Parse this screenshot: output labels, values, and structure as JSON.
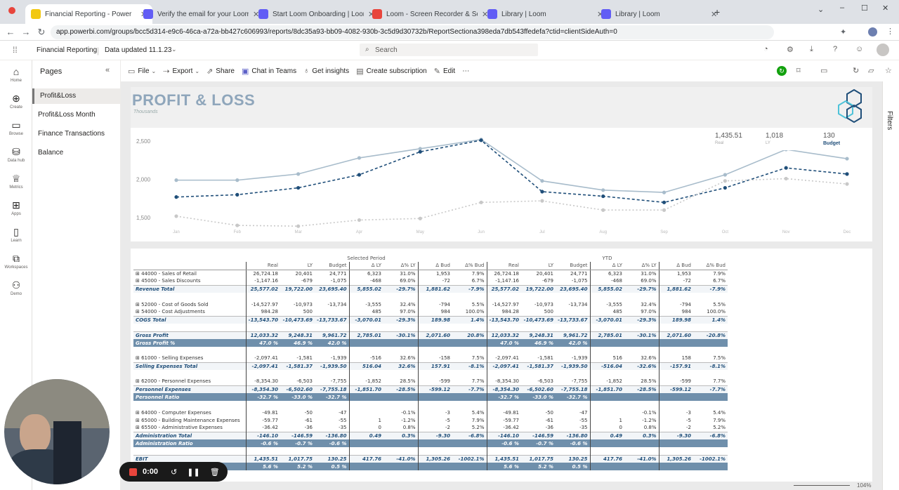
{
  "browser": {
    "tabs": [
      {
        "label": "Financial Reporting - Power",
        "color": "#f2c811",
        "active": true
      },
      {
        "label": "Verify the email for your Loom",
        "color": "#625df5",
        "active": false
      },
      {
        "label": "Start Loom Onboarding | Loom",
        "color": "#625df5",
        "active": false
      },
      {
        "label": "Loom - Screen Recorder & Scre",
        "color": "#e8453c",
        "active": false
      },
      {
        "label": "Library | Loom",
        "color": "#625df5",
        "active": false
      },
      {
        "label": "Library | Loom",
        "color": "#625df5",
        "active": false
      }
    ],
    "url": "app.powerbi.com/groups/bcc5d314-e9c6-46ca-a72a-bb427c606993/reports/8dc35a93-bb09-4082-930b-3c5d9d30732b/ReportSectiona398eda7db543ffedefa?ctid=clientSideAuth=0"
  },
  "pbi": {
    "report_name": "Financial Reporting",
    "data_updated": "Data updated 11.1.23",
    "search_placeholder": "Search"
  },
  "rail": [
    "Home",
    "Create",
    "Browse",
    "Data hub",
    "Metrics",
    "Apps",
    "Learn",
    "Workspaces",
    "Demo"
  ],
  "pages": {
    "title": "Pages",
    "items": [
      "Profit&Loss",
      "Profit&Loss Month",
      "Finance Transactions",
      "Balance"
    ]
  },
  "toolbar": {
    "file": "File",
    "export": "Export",
    "share": "Share",
    "chat": "Chat in Teams",
    "insights": "Get insights",
    "subscription": "Create subscription",
    "edit": "Edit"
  },
  "report": {
    "title": "PROFIT & LOSS",
    "subtitle": "Thousands",
    "filters_label": "Filters"
  },
  "kpi": {
    "real": "1,435.51",
    "real_label": "Real",
    "ly": "1,018",
    "ly_label": "LY",
    "budget": "130",
    "budget_label": "Budget"
  },
  "chart_data": {
    "type": "line",
    "x": [
      "Jan",
      "Feb",
      "Mar",
      "Apr",
      "May",
      "Jun",
      "Jul",
      "Aug",
      "Sep",
      "Oct",
      "Nov",
      "Dec"
    ],
    "ylim": [
      1300,
      2600
    ],
    "yticks": [
      "2,500",
      "2,000",
      "1,500"
    ],
    "series": [
      {
        "values": [
          1990,
          1990,
          2070,
          2280,
          2400,
          2520,
          1980,
          1860,
          1830,
          2060,
          2390,
          2270
        ],
        "color": "#a8bccb",
        "dash": ""
      },
      {
        "values": [
          1770,
          1800,
          1890,
          2060,
          2360,
          2510,
          1840,
          1780,
          1700,
          1890,
          2150,
          2070
        ],
        "color": "#1f4e79",
        "dash": "4,3"
      },
      {
        "values": [
          1520,
          1400,
          1390,
          1470,
          1490,
          1700,
          1720,
          1600,
          1600,
          1980,
          2010,
          1940
        ],
        "color": "#c8c8c8",
        "dash": "2,3"
      }
    ]
  },
  "table": {
    "group_selected": "Selected Period",
    "group_ytd": "YTD",
    "headers": [
      "Real",
      "LY",
      "Budget",
      "Δ LY",
      "Δ% LY",
      "Δ Bud",
      "Δ% Bud",
      "Real",
      "LY",
      "Budget",
      "Δ LY",
      "Δ% LY",
      "Δ Bud",
      "Δ% Bud"
    ],
    "rows": [
      {
        "type": "detail",
        "label": "⊞ 44000 - Sales of Retail",
        "v": [
          "26,724.18",
          "20,401",
          "24,771",
          "6,323",
          "31.0%",
          "1,953",
          "7.9%",
          "26,724.18",
          "20,401",
          "24,771",
          "6,323",
          "31.0%",
          "1,953",
          "7.9%"
        ]
      },
      {
        "type": "detail",
        "label": "⊞ 45000 - Sales Discounts",
        "v": [
          "-1,147.16",
          "-679",
          "-1,075",
          "-468",
          "69.0%",
          "-72",
          "6.7%",
          "-1,147.16",
          "-679",
          "-1,075",
          "-468",
          "69.0%",
          "-72",
          "6.7%"
        ]
      },
      {
        "type": "total",
        "label": "Revenue Total",
        "v": [
          "25,577.02",
          "19,722.00",
          "23,695.40",
          "5,855.02",
          "-29.7%",
          "1,881.62",
          "-7.9%",
          "25,577.02",
          "19,722.00",
          "23,695.40",
          "5,855.02",
          "-29.7%",
          "1,881.62",
          "-7.9%"
        ]
      },
      {
        "type": "blank",
        "label": "",
        "v": []
      },
      {
        "type": "detail",
        "label": "⊞ 52000 - Cost of Goods Sold",
        "v": [
          "-14,527.97",
          "-10,973",
          "-13,734",
          "-3,555",
          "32.4%",
          "-794",
          "5.5%",
          "-14,527.97",
          "-10,973",
          "-13,734",
          "-3,555",
          "32.4%",
          "-794",
          "5.5%"
        ]
      },
      {
        "type": "detail",
        "label": "⊞ 54000 - Cost Adjustments",
        "v": [
          "984.28",
          "500",
          "",
          "485",
          "97.0%",
          "984",
          "100.0%",
          "984.28",
          "500",
          "",
          "485",
          "97.0%",
          "984",
          "100.0%"
        ]
      },
      {
        "type": "total",
        "label": "COGS Total",
        "v": [
          "-13,543.70",
          "-10,473.69",
          "-13,733.67",
          "-3,070.01",
          "-29.3%",
          "189.98",
          "1.4%",
          "-13,543.70",
          "-10,473.69",
          "-13,733.67",
          "-3,070.01",
          "-29.3%",
          "189.98",
          "1.4%"
        ]
      },
      {
        "type": "blank",
        "label": "",
        "v": []
      },
      {
        "type": "total",
        "label": "Gross Profit",
        "v": [
          "12,033.32",
          "9,248.31",
          "9,961.72",
          "2,785.01",
          "-30.1%",
          "2,071.60",
          "20.8%",
          "12,033.32",
          "9,248.31",
          "9,961.72",
          "2,785.01",
          "-30.1%",
          "2,071.60",
          "-20.8%"
        ]
      },
      {
        "type": "ratio",
        "label": "Gross Profit %",
        "v": [
          "47.0 %",
          "46.9 %",
          "42.0 %",
          "",
          "",
          "",
          "",
          "47.0 %",
          "46.9 %",
          "42.0 %",
          "",
          "",
          "",
          ""
        ]
      },
      {
        "type": "blank",
        "label": "",
        "v": []
      },
      {
        "type": "detail",
        "label": "⊞ 61000 - Selling Expenses",
        "v": [
          "-2,097.41",
          "-1,581",
          "-1,939",
          "-516",
          "32.6%",
          "-158",
          "7.5%",
          "-2,097.41",
          "-1,581",
          "-1,939",
          "516",
          "32.6%",
          "158",
          "7.5%"
        ]
      },
      {
        "type": "total",
        "label": "Selling Expenses Total",
        "v": [
          "-2,097.41",
          "-1,581.37",
          "-1,939.50",
          "516.04",
          "32.6%",
          "157.91",
          "-8.1%",
          "-2,097.41",
          "-1,581.37",
          "-1,939.50",
          "-516.04",
          "-32.6%",
          "-157.91",
          "-8.1%"
        ]
      },
      {
        "type": "blank",
        "label": "",
        "v": []
      },
      {
        "type": "detail",
        "label": "⊞ 62000 - Personnel Expenses",
        "v": [
          "-8,354.30",
          "-6,503",
          "-7,755",
          "-1,852",
          "28.5%",
          "-599",
          "7.7%",
          "-8,354.30",
          "-6,503",
          "-7,755",
          "-1,852",
          "28.5%",
          "-599",
          "7.7%"
        ]
      },
      {
        "type": "total",
        "label": "Personnel Expenses",
        "v": [
          "-8,354.30",
          "-6,502.60",
          "-7,755.18",
          "-1,851.70",
          "-28.5%",
          "-599.12",
          "-7.7%",
          "-8,354.30",
          "-6,502.60",
          "-7,755.18",
          "-1,851.70",
          "-28.5%",
          "-599.12",
          "-7.7%"
        ]
      },
      {
        "type": "ratio",
        "label": "Personnel Ratio",
        "v": [
          "-32.7 %",
          "-33.0 %",
          "-32.7 %",
          "",
          "",
          "",
          "",
          "-32.7 %",
          "-33.0 %",
          "-32.7 %",
          "",
          "",
          "",
          ""
        ]
      },
      {
        "type": "blank",
        "label": "",
        "v": []
      },
      {
        "type": "detail",
        "label": "⊞ 64000 - Computer Expenses",
        "v": [
          "-49.81",
          "-50",
          "-47",
          "",
          "-0.1%",
          "-3",
          "5.4%",
          "-49.81",
          "-50",
          "-47",
          "",
          "-0.1%",
          "-3",
          "5.4%"
        ]
      },
      {
        "type": "detail",
        "label": "⊞ 65000 - Building Maintenance Expenses",
        "v": [
          "-59.77",
          "-61",
          "-55",
          "1",
          "-1.2%",
          "-5",
          "7.9%",
          "-59.77",
          "-61",
          "-55",
          "1",
          "-1.2%",
          "-5",
          "7.9%"
        ]
      },
      {
        "type": "detail",
        "label": "⊞ 65500 - Administrative Expenses",
        "v": [
          "-36.42",
          "-36",
          "-35",
          "0",
          "0.8%",
          "-2",
          "5.2%",
          "-36.42",
          "-36",
          "-35",
          "0",
          "0.8%",
          "-2",
          "5.2%"
        ]
      },
      {
        "type": "total",
        "label": "Administration Total",
        "v": [
          "-146.10",
          "-146.59",
          "-136.80",
          "0.49",
          "0.3%",
          "-9.30",
          "-6.8%",
          "-146.10",
          "-146.59",
          "-136.80",
          "0.49",
          "0.3%",
          "-9.30",
          "-6.8%"
        ]
      },
      {
        "type": "ratio",
        "label": "Administration Ratio",
        "v": [
          "-0.6 %",
          "-0.7 %",
          "-0.6 %",
          "",
          "",
          "",
          "",
          "-0.6 %",
          "-0.7 %",
          "-0.6 %",
          "",
          "",
          "",
          ""
        ]
      },
      {
        "type": "blank",
        "label": "",
        "v": []
      },
      {
        "type": "total",
        "label": "EBIT",
        "v": [
          "1,435.51",
          "1,017.75",
          "130.25",
          "417.76",
          "-41.0%",
          "1,305.26",
          "-1002.1%",
          "1,435.51",
          "1,017.75",
          "130.25",
          "417.76",
          "-41.0%",
          "1,305.26",
          "-1002.1%"
        ]
      },
      {
        "type": "ratio",
        "label": "",
        "v": [
          "5.6 %",
          "5.2 %",
          "0.5 %",
          "",
          "",
          "",
          "",
          "5.6 %",
          "5.2 %",
          "0.5 %",
          "",
          "",
          "",
          ""
        ]
      }
    ]
  },
  "recorder": {
    "time": "0:00"
  },
  "zoom": "104%"
}
